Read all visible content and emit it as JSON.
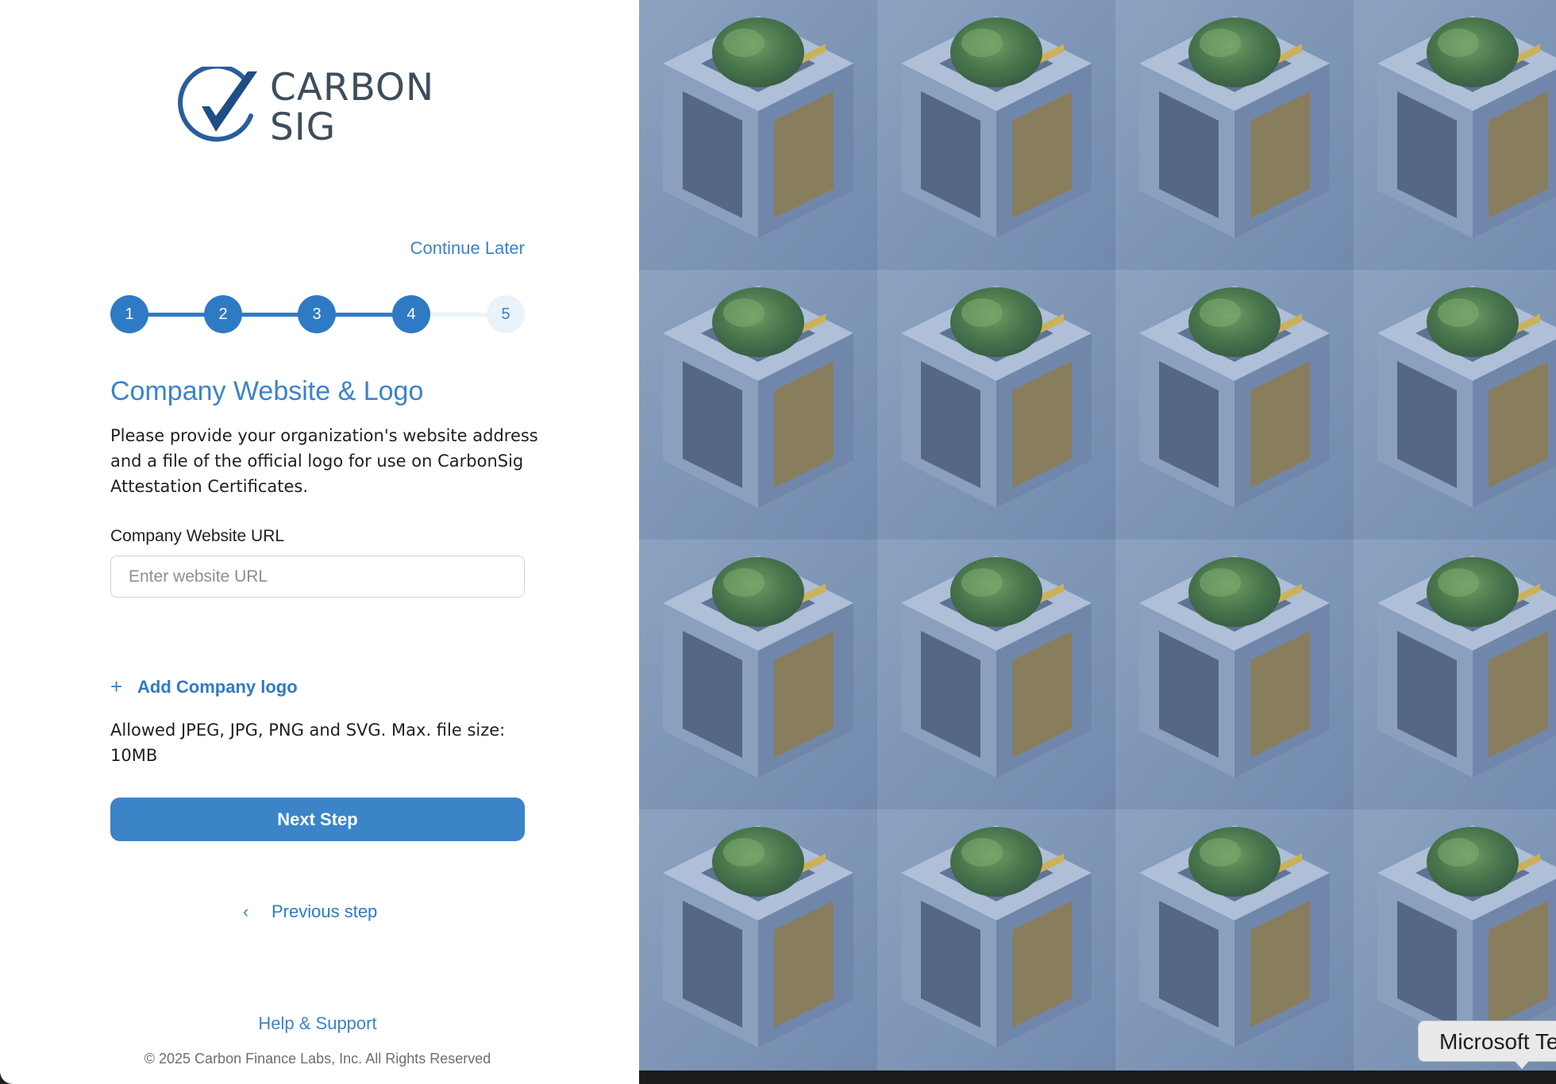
{
  "brand": {
    "logo_line1": "CARBON",
    "logo_line2": "SIG",
    "logo_icon": "check-circle-logo"
  },
  "header": {
    "continue_later": "Continue Later"
  },
  "stepper": {
    "current_step": 4,
    "total_steps": 5,
    "steps": [
      {
        "label": "1",
        "state": "completed"
      },
      {
        "label": "2",
        "state": "completed"
      },
      {
        "label": "3",
        "state": "completed"
      },
      {
        "label": "4",
        "state": "current"
      },
      {
        "label": "5",
        "state": "upcoming"
      }
    ]
  },
  "main": {
    "title": "Company Website & Logo",
    "description": "Please provide your organization's website address and a file of the official logo for use on CarbonSig Attestation Certificates.",
    "url_label": "Company Website URL",
    "url_value": "",
    "url_placeholder": "Enter website URL",
    "add_logo_label": "Add Company logo",
    "allowed_text": "Allowed JPEG, JPG, PNG and SVG. Max. file size: 10MB",
    "next_button": "Next Step",
    "previous_step": "Previous step"
  },
  "footer": {
    "help": "Help & Support",
    "copyright": "© 2025 Carbon Finance Labs, Inc. All Rights Reserved"
  },
  "tooltip": {
    "text": "Microsoft Te"
  },
  "colors": {
    "accent": "#3b84c8",
    "accent_dark": "#2f7ac4",
    "step_todo_bg": "#eaf3fb",
    "logo_navy": "#1f4d86",
    "text": "#1f1f1f"
  },
  "icons": {
    "plus": "plus-icon",
    "chevron_left": "chevron-left-icon"
  }
}
